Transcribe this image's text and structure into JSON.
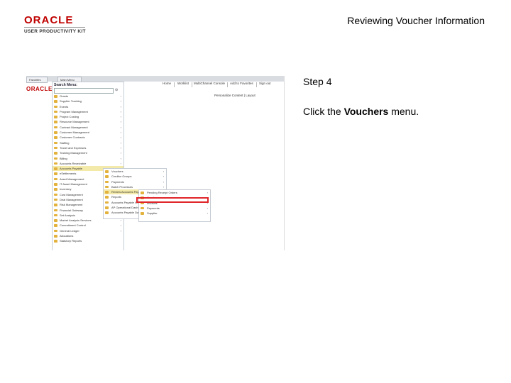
{
  "header": {
    "logo_text": "ORACLE",
    "logo_subtext": "USER PRODUCTIVITY KIT",
    "title": "Reviewing Voucher Information"
  },
  "step": {
    "title": "Step 4",
    "instruction_prefix": "Click the ",
    "instruction_target": "Vouchers",
    "instruction_suffix": " menu."
  },
  "screenshot": {
    "tabs": [
      "Favorites",
      "Main Menu"
    ],
    "mini_logo": "ORACLE",
    "topnav": [
      "Home",
      "Worklist",
      "MultiChannel Console",
      "Add to Favorites",
      "Sign out"
    ],
    "personalize": "Personalize Content | Layout",
    "menu_title": "Search Menu:",
    "main_menu": [
      "Grants",
      "Supplier Tracking",
      "Events",
      "Program Management",
      "Project Costing",
      "Resource Management",
      "Contract Management",
      "Customer Management",
      "Customer Contracts",
      "Staffing",
      "Travel and Expenses",
      "Training Management",
      "Billing",
      "Accounts Receivable",
      "Accounts Payable",
      "eSettlements",
      "Asset Management",
      "IT Asset Management",
      "Inventory",
      "Cost Management",
      "Deal Management",
      "Risk Management",
      "Financial Gateway",
      "Set Analysis",
      "Market Analysis Services",
      "Commitment Control",
      "General Ledger",
      "Allocations",
      "Statutory Reports"
    ],
    "accounts_payable_menu": [
      "Vouchers",
      "Creditor Groups",
      "Payments",
      "Batch Processes",
      "Review Accounts Payable Info",
      "Reports",
      "Accounts Payable WorkCenter",
      "AP Operational Dashboard",
      "Accounts Payable Dashboard"
    ],
    "review_menu": [
      "Pending Receipt Orders",
      "Vouchers",
      "Invoices",
      "Payments",
      "Supplier"
    ]
  }
}
